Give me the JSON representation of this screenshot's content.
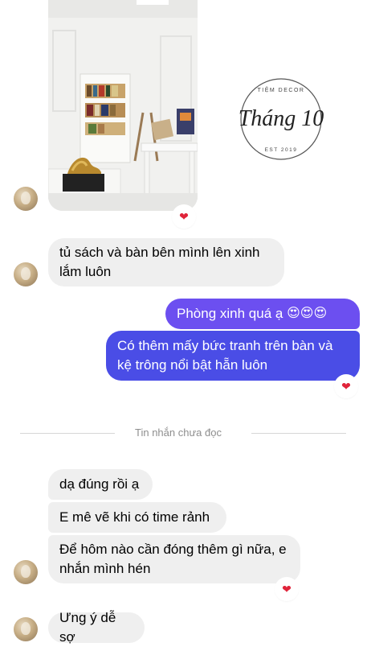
{
  "photo": {
    "watermark_brand": "Tháng 10",
    "watermark_top": "TIỆM DECOR",
    "watermark_bottom": "EST 2019",
    "reaction_icon": "heart-icon"
  },
  "messages": [
    {
      "side": "in",
      "text": "tủ sách và bàn bên mình lên xinh lắm luôn"
    },
    {
      "side": "out",
      "text": "Phòng xinh quá ạ",
      "emoji": "😍😍😍"
    },
    {
      "side": "out",
      "text": "Có thêm mấy bức tranh trên bàn và kệ trông nổi bật hẵn luôn",
      "reaction": "❤"
    },
    {
      "side": "in",
      "text": "dạ đúng rồi ạ"
    },
    {
      "side": "in",
      "text": "E mê vẽ khi có time rảnh"
    },
    {
      "side": "in",
      "text": "Để hôm nào cần đóng thêm gì nữa, e nhắn mình hén",
      "reaction": "❤"
    },
    {
      "side": "in",
      "text": "Ưng ý dễ sợ"
    }
  ],
  "photo_reaction": "❤",
  "divider": {
    "label": "Tin nhắn chưa đọc"
  },
  "colors": {
    "outgoing_top": "#6c4ff0",
    "outgoing_bottom": "#3a4fe0",
    "incoming_bg": "#efefef",
    "reaction_heart": "#e0243a"
  }
}
